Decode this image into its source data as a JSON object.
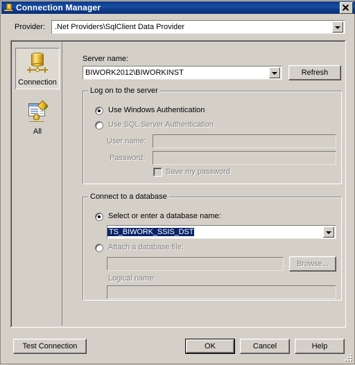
{
  "window": {
    "title": "Connection Manager",
    "title_icon": "database-connection-icon",
    "close_icon": "close-icon",
    "accent_color": "#0a3a8e",
    "face_color": "#d4d0c8",
    "selection_color": "#0a246a"
  },
  "provider": {
    "label": "Provider:",
    "value": ".Net Providers\\SqlClient Data Provider",
    "dropdown_icon": "chevron-down-icon"
  },
  "sidebar": {
    "items": [
      {
        "label": "Connection",
        "icon": "database-icon",
        "selected": true
      },
      {
        "label": "All",
        "icon": "properties-list-icon",
        "selected": false
      }
    ]
  },
  "server": {
    "label": "Server name:",
    "value": "BIWORK2012\\BIWORKINST",
    "dropdown_icon": "chevron-down-icon",
    "refresh_label": "Refresh"
  },
  "logon_group": {
    "caption": "Log on to the server",
    "windows_auth_label": "Use Windows Authentication",
    "windows_auth_selected": true,
    "sql_auth_label": "Use SQL Server Authentication",
    "sql_auth_selected": false,
    "user_name_label": "User name:",
    "user_name_value": "",
    "password_label": "Password:",
    "password_value": "",
    "save_password_label": "Save my password",
    "save_password_checked": false
  },
  "database_group": {
    "caption": "Connect to a database",
    "select_db_label": "Select or enter a database name:",
    "select_db_selected": true,
    "database_value": "TS_BIWORK_SSIS_DST",
    "database_value_highlighted": true,
    "dropdown_icon": "chevron-down-icon",
    "attach_file_label": "Attach a database file:",
    "attach_file_selected": false,
    "attach_file_value": "",
    "browse_label": "Browse...",
    "logical_name_label": "Logical name:",
    "logical_name_value": ""
  },
  "footer": {
    "test_connection_label": "Test Connection",
    "ok_label": "OK",
    "cancel_label": "Cancel",
    "help_label": "Help",
    "default_button": "OK",
    "resize_grip_icon": "resize-grip-icon"
  }
}
